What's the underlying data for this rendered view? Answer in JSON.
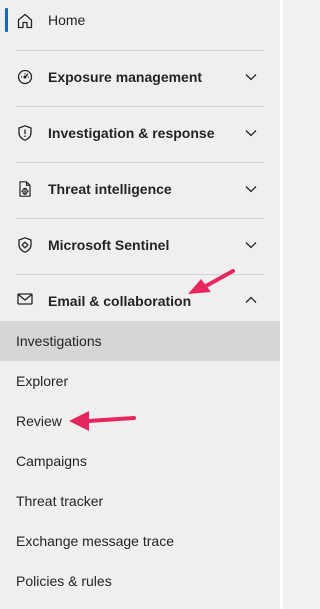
{
  "nav": {
    "home": {
      "label": "Home",
      "icon": "home-icon"
    },
    "sections": [
      {
        "label": "Exposure management",
        "icon": "gauge-icon",
        "expanded": false
      },
      {
        "label": "Investigation & response",
        "icon": "shield-alert-icon",
        "expanded": false
      },
      {
        "label": "Threat intelligence",
        "icon": "document-bug-icon",
        "expanded": false
      },
      {
        "label": "Microsoft Sentinel",
        "icon": "shield-gear-icon",
        "expanded": false
      },
      {
        "label": "Email & collaboration",
        "icon": "mail-icon",
        "expanded": true
      }
    ],
    "email_items": [
      {
        "label": "Investigations",
        "active": true
      },
      {
        "label": "Explorer",
        "active": false
      },
      {
        "label": "Review",
        "active": false
      },
      {
        "label": "Campaigns",
        "active": false
      },
      {
        "label": "Threat tracker",
        "active": false
      },
      {
        "label": "Exchange message trace",
        "active": false
      },
      {
        "label": "Policies & rules",
        "active": false
      }
    ]
  },
  "colors": {
    "accent": "#0f6cbd",
    "annotation_arrow": "#e6265d",
    "active_item_bg": "#d6d6d6",
    "nav_bg": "#efefef"
  }
}
